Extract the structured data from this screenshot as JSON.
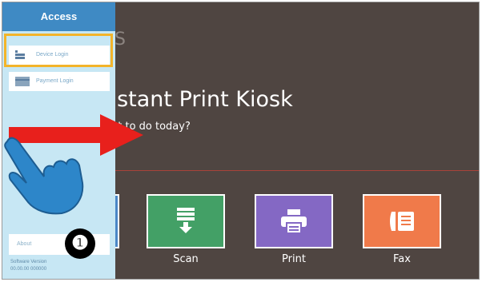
{
  "sidebar": {
    "header": "Access",
    "items": [
      {
        "label": "Device Login",
        "icon": "device-icon"
      },
      {
        "label": "Payment Login",
        "icon": "card-icon"
      }
    ],
    "about_label": "About",
    "footer_lines": [
      "Software Version",
      "00.00.00 000000"
    ]
  },
  "main": {
    "logo_fragment": "S",
    "title": "nstant Print Kiosk",
    "subtitle": "nt to do today?",
    "tiles": [
      {
        "label": "",
        "icon": "copy-icon",
        "color": "#4a86c6"
      },
      {
        "label": "Scan",
        "icon": "scan-icon",
        "color": "#43a066"
      },
      {
        "label": "Print",
        "icon": "printer-icon",
        "color": "#8468c4"
      },
      {
        "label": "Fax",
        "icon": "fax-icon",
        "color": "#f07a4a"
      }
    ]
  },
  "annotation": {
    "step_number": "❶",
    "highlight_color": "#f3b42a",
    "arrow_color": "#e8201c",
    "hand_color": "#2d86c9"
  }
}
